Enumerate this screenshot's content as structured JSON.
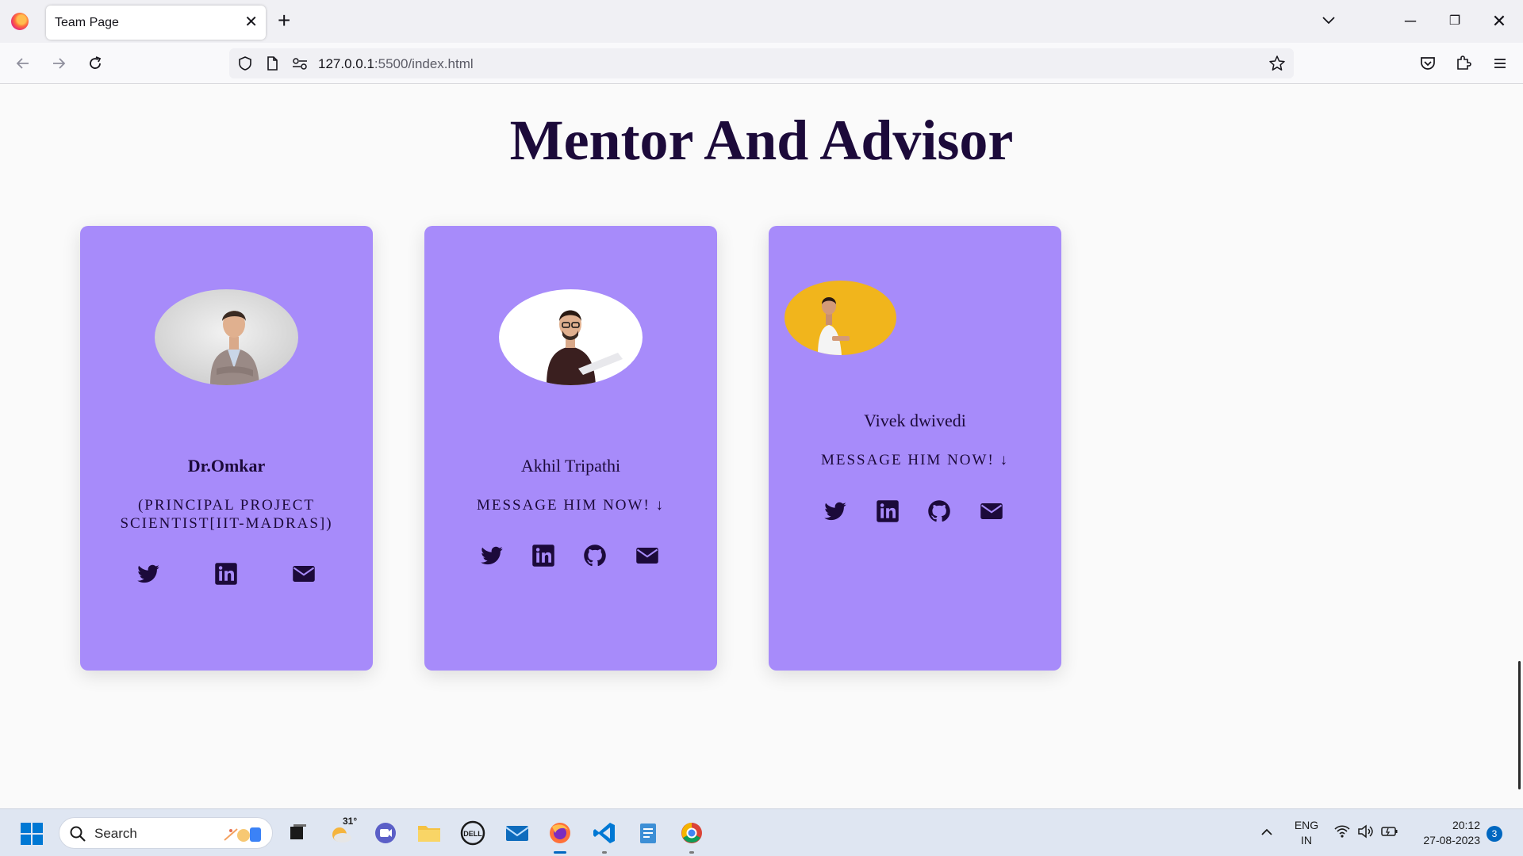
{
  "browser": {
    "tab_title": "Team Page",
    "tab_close": "✕",
    "new_tab": "+",
    "url_host": "127.0.0.1",
    "url_rest": ":5500/index.html",
    "window_min": "─",
    "window_restore": "❐",
    "window_close": "✕"
  },
  "page": {
    "title": "Mentor And Advisor",
    "colors": {
      "card": "#a78bfa",
      "text": "#1c0a3a",
      "background": "#fafafa"
    }
  },
  "cards": [
    {
      "name": "Dr.Omkar",
      "subtitle": "(PRINCIPAL PROJECT SCIENTIST[IIT-MADRAS])",
      "avatar_icon": "person-photo",
      "socials": [
        "twitter-icon",
        "linkedin-icon",
        "envelope-icon"
      ]
    },
    {
      "name": "Akhil Tripathi",
      "subtitle": "MESSAGE HIM NOW! ↓",
      "avatar_icon": "person-photo",
      "socials": [
        "twitter-icon",
        "linkedin-icon",
        "github-icon",
        "envelope-icon"
      ]
    },
    {
      "name": "Vivek dwivedi",
      "subtitle": "MESSAGE HIM NOW! ↓",
      "avatar_icon": "person-photo",
      "socials": [
        "twitter-icon",
        "linkedin-icon",
        "github-icon",
        "envelope-icon"
      ]
    }
  ],
  "taskbar": {
    "search_label": "Search",
    "weather_temp": "31°",
    "lang_line1": "ENG",
    "lang_line2": "IN",
    "time": "20:12",
    "date": "27-08-2023",
    "notification_count": "3"
  }
}
